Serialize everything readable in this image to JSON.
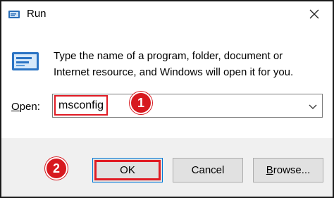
{
  "window": {
    "title": "Run",
    "close_icon": "close-icon",
    "app_icon": "run-app-icon"
  },
  "body": {
    "description_line1": "Type the name of a program, folder, document or",
    "description_line2": "Internet resource, and Windows will open it for you.",
    "run_icon": "run-dialog-icon"
  },
  "open_field": {
    "label_prefix": "",
    "label_accesskey": "O",
    "label_rest": "pen:",
    "value": "msconfig",
    "dropdown_icon": "chevron-down-icon"
  },
  "buttons": {
    "ok_label": "OK",
    "cancel_label": "Cancel",
    "browse_accesskey": "B",
    "browse_rest": "rowse..."
  },
  "annotations": {
    "step1": "1",
    "step2": "2",
    "highlight_color": "#e01b24",
    "badge_color": "#d7191f"
  }
}
